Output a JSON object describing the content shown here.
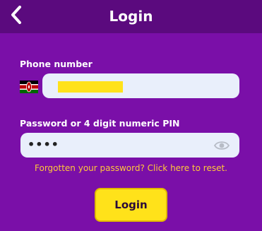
{
  "header": {
    "title": "Login",
    "back_icon": "chevron-left-icon"
  },
  "phone": {
    "label": "Phone number",
    "country_flag": "kenya-flag-icon",
    "value": ""
  },
  "password": {
    "label": "Password or 4 digit numeric PIN",
    "masked_value": "••••",
    "toggle_icon": "eye-icon"
  },
  "forgot_link": "Forgotten your password? Click here to reset.",
  "login_button": "Login",
  "colors": {
    "background": "#7a0fa8",
    "header": "#5b0a7e",
    "accent_yellow": "#ffe21a",
    "link": "#ffc83a",
    "input_bg": "#e9effb"
  }
}
